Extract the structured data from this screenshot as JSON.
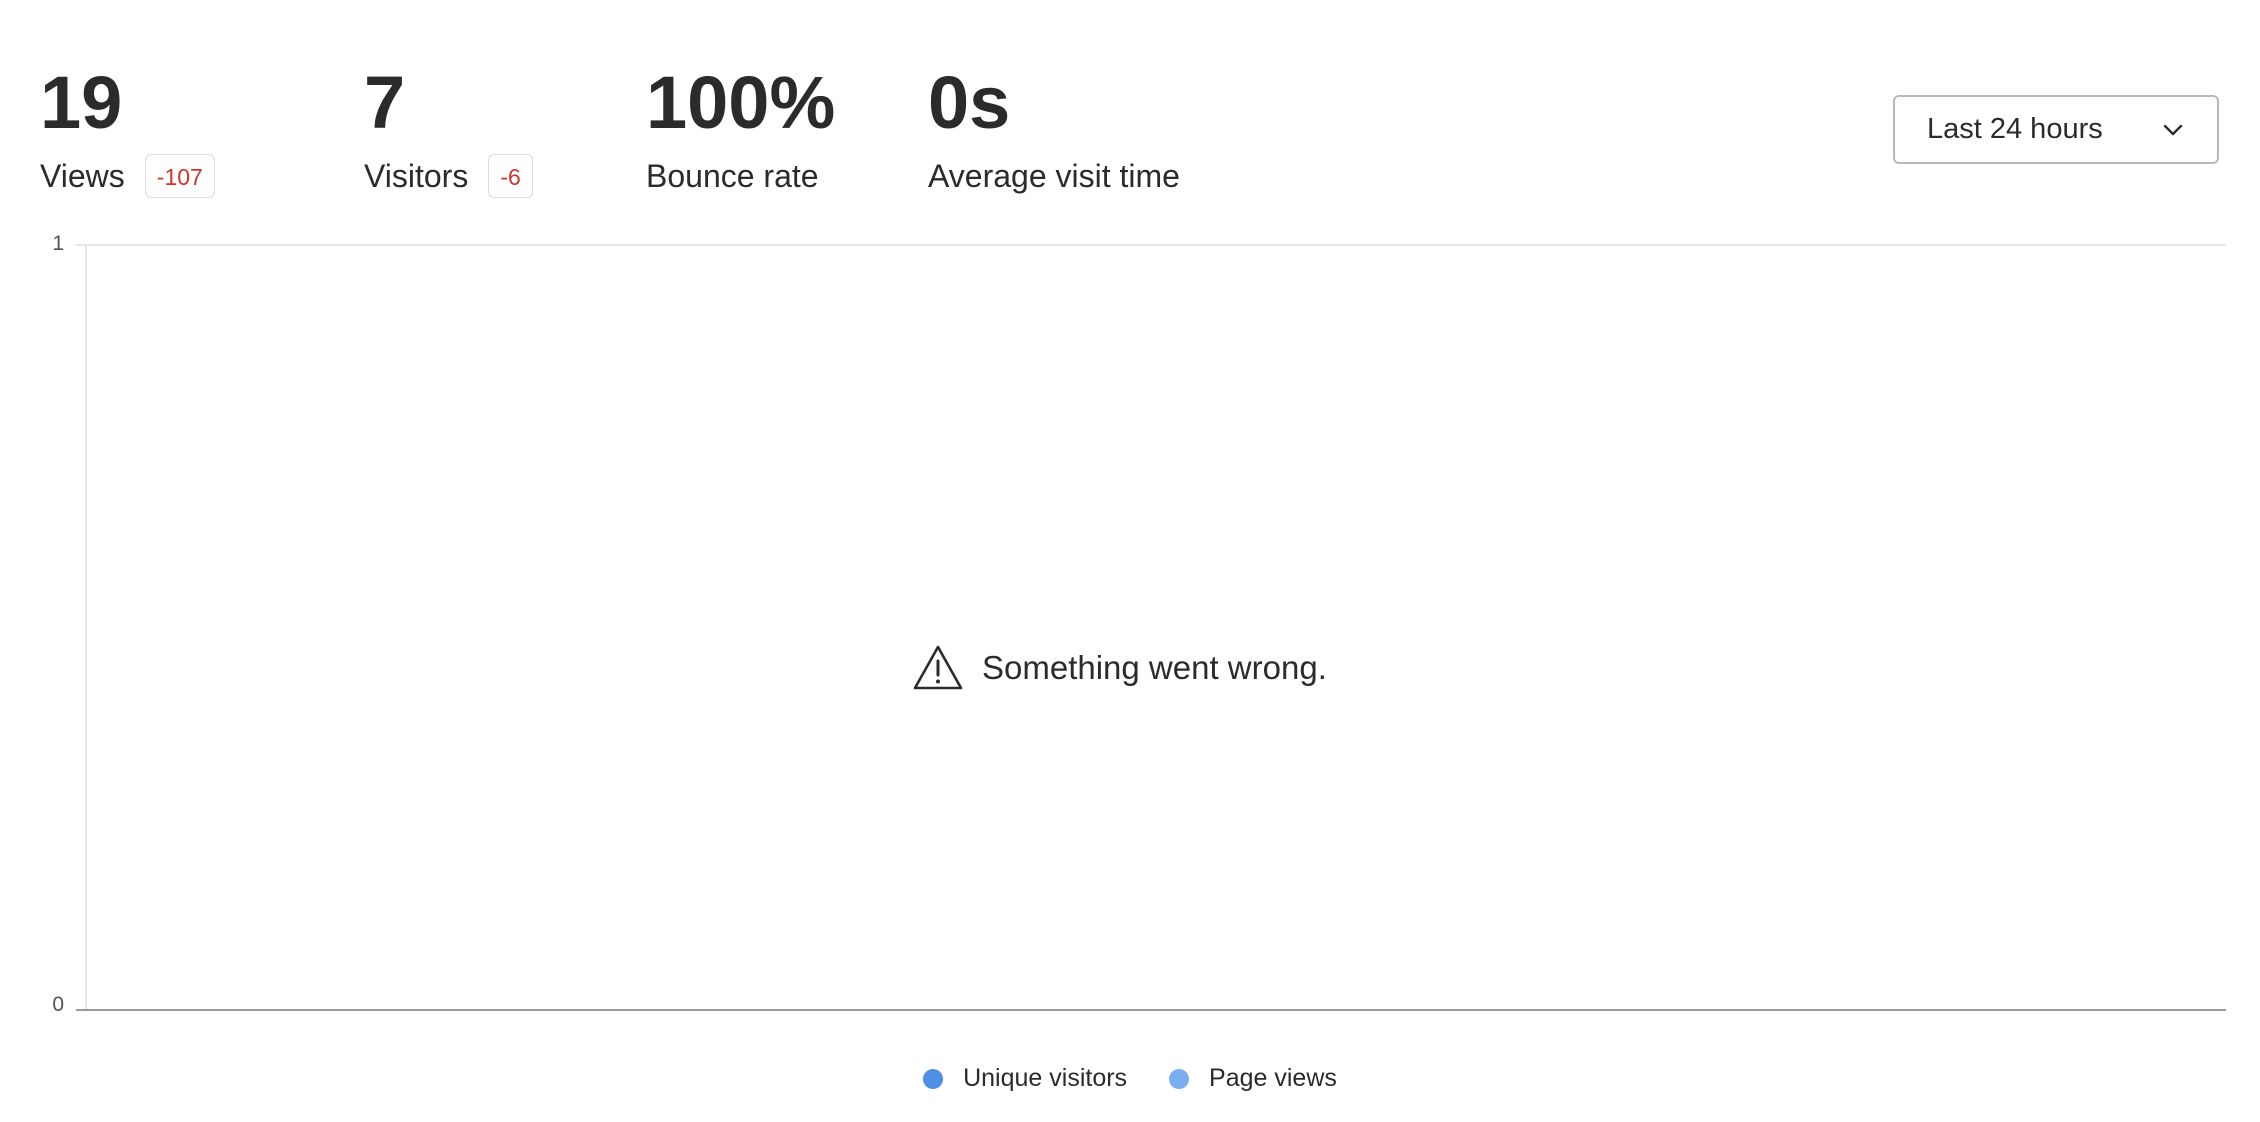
{
  "metrics": [
    {
      "value": "19",
      "label": "Views",
      "change": "-107"
    },
    {
      "value": "7",
      "label": "Visitors",
      "change": "-6"
    },
    {
      "value": "100%",
      "label": "Bounce rate"
    },
    {
      "value": "0s",
      "label": "Average visit time"
    }
  ],
  "date_range": {
    "selected": "Last 24 hours",
    "icon": "chevron-down-icon"
  },
  "chart": {
    "y_ticks": [
      "1",
      "0"
    ],
    "error_message": "Something went wrong.",
    "error_icon": "warning-triangle-icon",
    "legend": [
      {
        "label": "Unique visitors",
        "color": "#4f8fe6"
      },
      {
        "label": "Page views",
        "color": "#7aaef0"
      }
    ]
  },
  "colors": {
    "text": "#2b2b2b",
    "negative_change": "#d0342c",
    "axis": "#9a9a9a",
    "grid": "#e6e6e6"
  },
  "chart_data": {
    "type": "line",
    "ylim": [
      0,
      1
    ],
    "y_ticks": [
      0,
      1
    ],
    "series": [
      {
        "name": "Unique visitors",
        "values": []
      },
      {
        "name": "Page views",
        "values": []
      }
    ],
    "legend_position": "bottom",
    "grid": true
  }
}
